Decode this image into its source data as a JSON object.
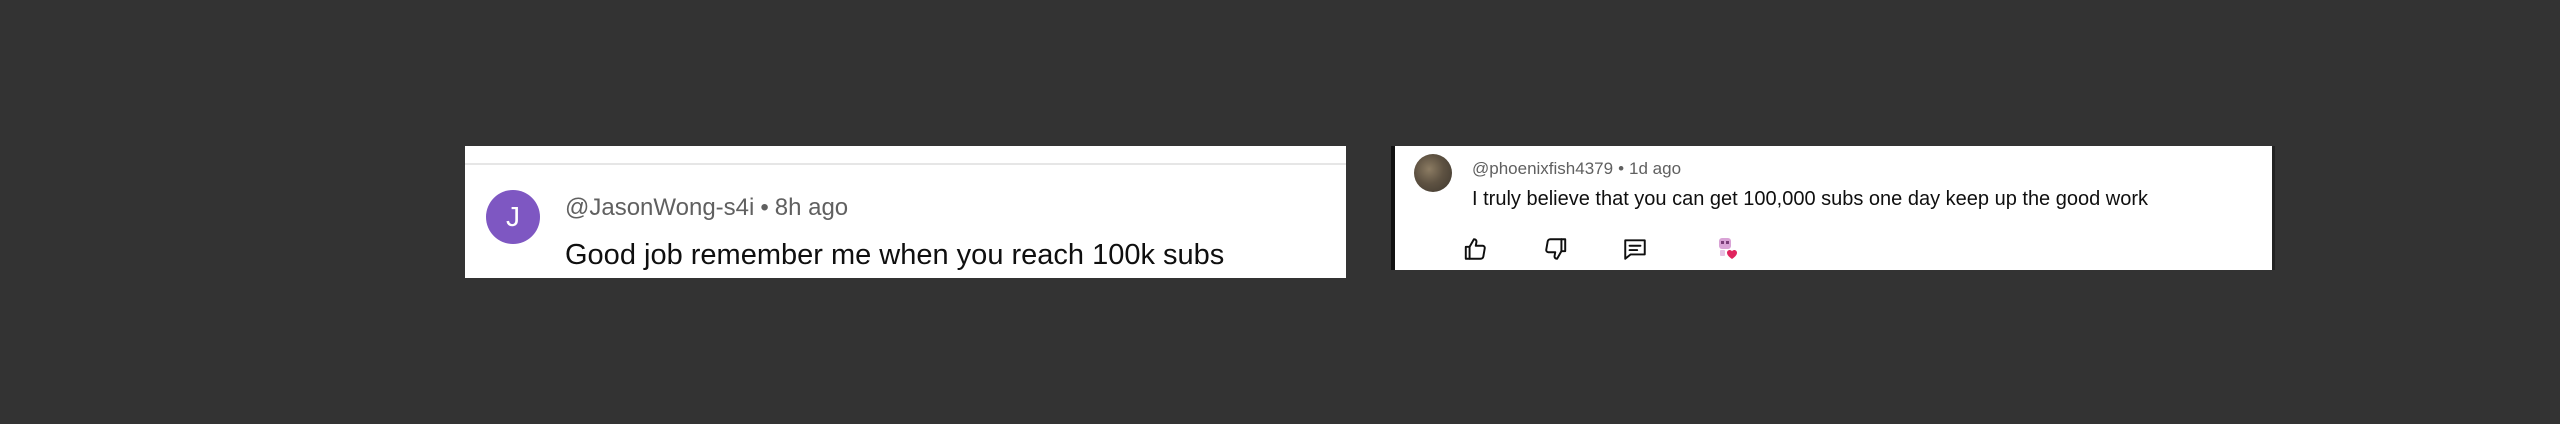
{
  "comments": [
    {
      "avatar_letter": "J",
      "avatar_color": "#7e57c2",
      "author": "@JasonWong-s4i",
      "separator": "•",
      "time": "8h ago",
      "text": "Good job remember me when you reach 100k subs"
    },
    {
      "author": "@phoenixfish4379",
      "separator": "•",
      "time": "1d ago",
      "text": "I truly believe that you can get 100,000 subs one day keep up the good work",
      "actions": [
        "thumbs-up-icon",
        "thumbs-down-icon",
        "reply-icon",
        "creator-heart-icon"
      ]
    }
  ],
  "colors": {
    "background": "#333333",
    "card": "#ffffff",
    "meta_text": "#606060",
    "body_text": "#0f0f0f",
    "heart": "#e0245e"
  }
}
